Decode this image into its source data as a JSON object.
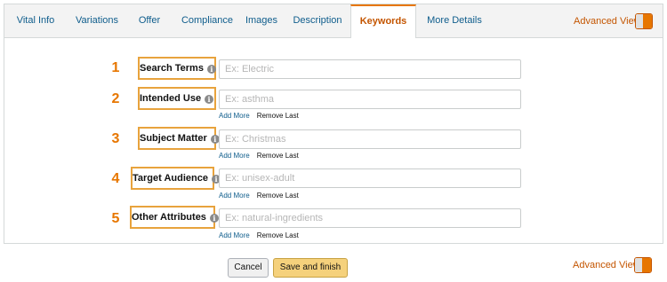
{
  "tabs": [
    {
      "label": "Vital Info"
    },
    {
      "label": "Variations"
    },
    {
      "label": "Offer"
    },
    {
      "label": "Compliance"
    },
    {
      "label": "Images"
    },
    {
      "label": "Description"
    },
    {
      "label": "Keywords",
      "active": true
    },
    {
      "label": "More Details"
    }
  ],
  "advanced_view": {
    "label": "Advanced View",
    "enabled": true
  },
  "rows": [
    {
      "number": "1",
      "label": "Search Terms",
      "placeholder": "Ex: Electric",
      "add_more": "",
      "remove_last": ""
    },
    {
      "number": "2",
      "label": "Intended Use",
      "placeholder": "Ex: asthma",
      "add_more": "Add More",
      "remove_last": "Remove Last"
    },
    {
      "number": "3",
      "label": "Subject Matter",
      "placeholder": "Ex: Christmas",
      "add_more": "Add More",
      "remove_last": "Remove Last"
    },
    {
      "number": "4",
      "label": "Target Audience",
      "placeholder": "Ex: unisex-adult",
      "add_more": "Add More",
      "remove_last": "Remove Last"
    },
    {
      "number": "5",
      "label": "Other Attributes",
      "placeholder": "Ex: natural-ingredients",
      "add_more": "Add More",
      "remove_last": "Remove Last"
    }
  ],
  "footer": {
    "cancel_label": "Cancel",
    "save_label": "Save and finish",
    "advanced_view_label": "Advanced View"
  },
  "colors": {
    "accent": "#e77600",
    "link": "#0f5d8c",
    "highlight_border": "#e8a33d",
    "save_button": "#f5d17c"
  },
  "icons": [
    "info-icon",
    "toggle-switch"
  ]
}
